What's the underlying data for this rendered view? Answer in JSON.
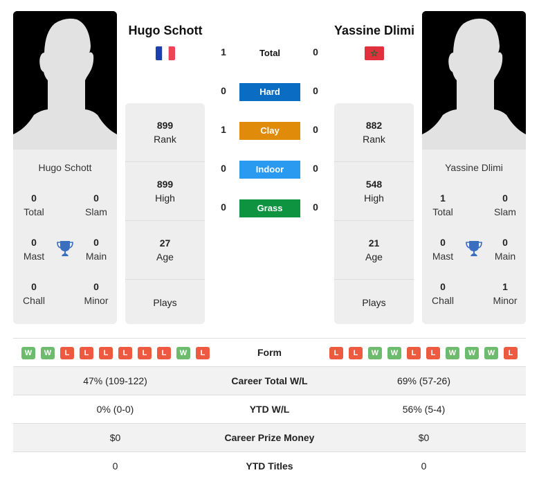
{
  "player1": {
    "name": "Hugo Schott",
    "country_flag": "france-flag",
    "titles": {
      "total": "0",
      "slam": "0",
      "mast": "0",
      "main": "0",
      "chall": "0",
      "minor": "0"
    },
    "rank": "899",
    "high": "899",
    "age": "27",
    "plays": "",
    "form": [
      "W",
      "W",
      "L",
      "L",
      "L",
      "L",
      "L",
      "L",
      "W",
      "L"
    ],
    "career_total_wl": "47% (109-122)",
    "ytd_wl": "0% (0-0)",
    "career_prize": "$0",
    "ytd_titles": "0"
  },
  "player2": {
    "name": "Yassine Dlimi",
    "country_flag": "morocco-flag",
    "titles": {
      "total": "1",
      "slam": "0",
      "mast": "0",
      "main": "0",
      "chall": "0",
      "minor": "1"
    },
    "rank": "882",
    "high": "548",
    "age": "21",
    "plays": "",
    "form": [
      "L",
      "L",
      "W",
      "W",
      "L",
      "L",
      "W",
      "W",
      "W",
      "L"
    ],
    "career_total_wl": "69% (57-26)",
    "ytd_wl": "56% (5-4)",
    "career_prize": "$0",
    "ytd_titles": "0"
  },
  "labels": {
    "total": "Total",
    "slam": "Slam",
    "mast": "Mast",
    "main": "Main",
    "chall": "Chall",
    "minor": "Minor",
    "rank": "Rank",
    "high": "High",
    "age": "Age",
    "plays": "Plays",
    "form": "Form",
    "career_total_wl": "Career Total W/L",
    "ytd_wl": "YTD W/L",
    "career_prize": "Career Prize Money",
    "ytd_titles": "YTD Titles"
  },
  "h2h": {
    "total": {
      "label": "Total",
      "p1": "1",
      "p2": "0"
    },
    "surfaces": [
      {
        "label": "Hard",
        "p1": "0",
        "p2": "0",
        "color": "#0a6cc2"
      },
      {
        "label": "Clay",
        "p1": "1",
        "p2": "0",
        "color": "#e08c0a"
      },
      {
        "label": "Indoor",
        "p1": "0",
        "p2": "0",
        "color": "#2a9af0"
      },
      {
        "label": "Grass",
        "p1": "0",
        "p2": "0",
        "color": "#0e9340"
      }
    ]
  },
  "colors": {
    "win": "#6dbb6d",
    "loss": "#ee5a40",
    "trophy": "#3a6fc0"
  }
}
